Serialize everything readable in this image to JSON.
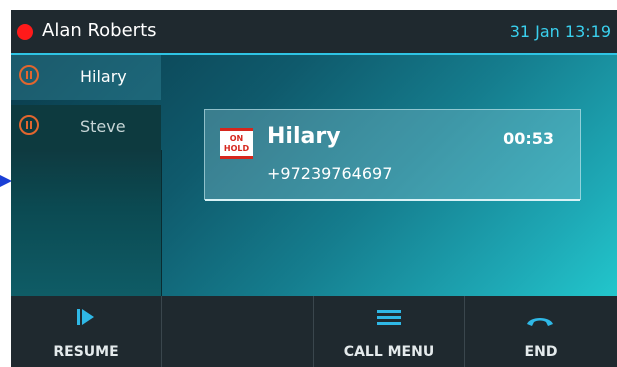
{
  "status_bar": {
    "owner_name": "Alan Roberts",
    "date_time": "31 Jan 13:19",
    "status_dot_color": "#ff1a1a"
  },
  "call_list": [
    {
      "name": "Hilary",
      "state_icon": "hold-icon"
    },
    {
      "name": "Steve",
      "state_icon": "hold-icon"
    }
  ],
  "active_call": {
    "badge_line1": "ON",
    "badge_line2": "HOLD",
    "name": "Hilary",
    "timer": "00:53",
    "number": "+97239764697"
  },
  "softkeys": [
    {
      "label": "RESUME",
      "icon": "resume-icon"
    },
    {
      "label": "",
      "icon": ""
    },
    {
      "label": "CALL MENU",
      "icon": "menu-icon"
    },
    {
      "label": "END",
      "icon": "end-call-icon"
    }
  ],
  "colors": {
    "accent": "#2fb8e6",
    "hold": "#e2662e",
    "onhold_badge": "#d6261d",
    "bar_background": "#1f292f"
  }
}
